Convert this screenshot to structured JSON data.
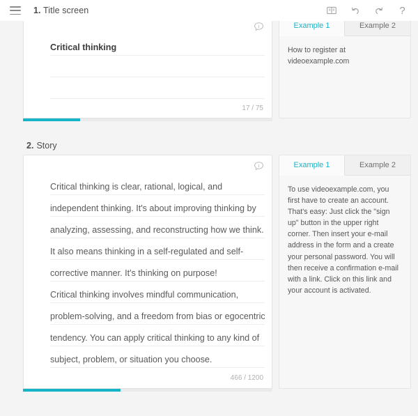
{
  "topbar": {
    "menu_icon": "hamburger-menu-icon",
    "title_number": "1.",
    "title_text": "Title screen",
    "actions": [
      {
        "name": "manual-icon",
        "label": "Manual"
      },
      {
        "name": "undo-icon",
        "label": "Undo"
      },
      {
        "name": "redo-icon",
        "label": "Redo"
      },
      {
        "name": "help-icon",
        "label": "?"
      }
    ]
  },
  "colors": {
    "accent": "#17b3c6",
    "page_background": "#f4f4f4",
    "card_background": "#ffffff",
    "panel_background": "#f7f7f7",
    "text": "#4a4a4a",
    "muted_text": "#b0b0b0"
  },
  "sections": [
    {
      "number": "1.",
      "name": "Title screen",
      "comment_icon": "comment-bubble-icon",
      "lines": [
        "Critical thinking",
        "",
        ""
      ],
      "counter": "17 / 75",
      "progress_percent": 23,
      "panel": {
        "tabs": [
          {
            "label": "Example 1",
            "active": true
          },
          {
            "label": "Example 2",
            "active": false
          }
        ],
        "body": "How to register at videoexample.com"
      }
    },
    {
      "number": "2.",
      "name": "Story",
      "comment_icon": "comment-bubble-icon",
      "lines": [
        "Critical thinking is clear, rational, logical, and",
        "independent thinking. It's about improving thinking by",
        "analyzing, assessing, and reconstructing how we think.",
        "It also means thinking in a self-regulated and self-",
        "corrective manner. It's thinking on purpose!",
        "Critical thinking involves mindful communication,",
        "problem-solving, and a freedom from bias or egocentric",
        "tendency. You can apply critical thinking to any kind of",
        "subject, problem, or situation you choose."
      ],
      "counter": "466 / 1200",
      "progress_percent": 39,
      "panel": {
        "tabs": [
          {
            "label": "Example 1",
            "active": true
          },
          {
            "label": "Example 2",
            "active": false
          }
        ],
        "body": "To use videoexample.com, you first have to create an account. That's easy: Just click the \"sign up\" button in the upper right corner. Then insert your e-mail address in the form and a create your personal password. You will then receive a confirmation e-mail with a link. Click on this link and your account is activated."
      }
    }
  ]
}
